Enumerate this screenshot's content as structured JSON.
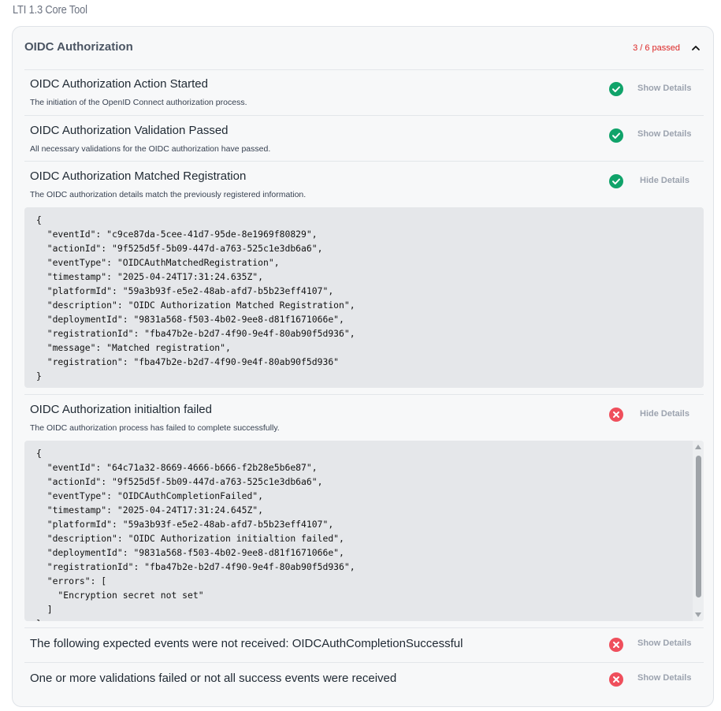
{
  "app_title": "LTI 1.3 Core Tool",
  "panel": {
    "title": "OIDC Authorization",
    "passed_label": "3 / 6 passed",
    "chevron_icon": "chevron-up-icon"
  },
  "colors": {
    "success": "#10a36a",
    "failure": "#ef4f5c",
    "passed_text": "#dc2626"
  },
  "rows": [
    {
      "title": "OIDC Authorization Action Started",
      "description": "The initiation of the OpenID Connect authorization process.",
      "status": "success",
      "status_icon": "check-circle-icon",
      "button": "Show Details"
    },
    {
      "title": "OIDC Authorization Validation Passed",
      "description": "All necessary validations for the OIDC authorization have passed.",
      "status": "success",
      "status_icon": "check-circle-icon",
      "button": "Show Details"
    },
    {
      "title": "OIDC Authorization Matched Registration",
      "description": "The OIDC authorization details match the previously registered information.",
      "status": "success",
      "status_icon": "check-circle-icon",
      "button": "Hide Details",
      "details": "{\n  \"eventId\": \"c9ce87da-5cee-41d7-95de-8e1969f80829\",\n  \"actionId\": \"9f525d5f-5b09-447d-a763-525c1e3db6a6\",\n  \"eventType\": \"OIDCAuthMatchedRegistration\",\n  \"timestamp\": \"2025-04-24T17:31:24.635Z\",\n  \"platformId\": \"59a3b93f-e5e2-48ab-afd7-b5b23eff4107\",\n  \"description\": \"OIDC Authorization Matched Registration\",\n  \"deploymentId\": \"9831a568-f503-4b02-9ee8-d81f1671066e\",\n  \"registrationId\": \"fba47b2e-b2d7-4f90-9e4f-80ab90f5d936\",\n  \"message\": \"Matched registration\",\n  \"registration\": \"fba47b2e-b2d7-4f90-9e4f-80ab90f5d936\"\n}"
    },
    {
      "title": "OIDC Authorization initialtion failed",
      "description": "The OIDC authorization process has failed to complete successfully.",
      "status": "failure",
      "status_icon": "x-circle-icon",
      "button": "Hide Details",
      "details": "{\n  \"eventId\": \"64c71a32-8669-4666-b666-f2b28e5b6e87\",\n  \"actionId\": \"9f525d5f-5b09-447d-a763-525c1e3db6a6\",\n  \"eventType\": \"OIDCAuthCompletionFailed\",\n  \"timestamp\": \"2025-04-24T17:31:24.645Z\",\n  \"platformId\": \"59a3b93f-e5e2-48ab-afd7-b5b23eff4107\",\n  \"description\": \"OIDC Authorization initialtion failed\",\n  \"deploymentId\": \"9831a568-f503-4b02-9ee8-d81f1671066e\",\n  \"registrationId\": \"fba47b2e-b2d7-4f90-9e4f-80ab90f5d936\",\n  \"errors\": [\n    \"Encryption secret not set\"\n  ]\n}"
    },
    {
      "title": "The following expected events were not received: OIDCAuthCompletionSuccessful",
      "status": "failure",
      "status_icon": "x-circle-icon",
      "button": "Show Details"
    },
    {
      "title": "One or more validations failed or not all success events were received",
      "status": "failure",
      "status_icon": "x-circle-icon",
      "button": "Show Details"
    }
  ]
}
